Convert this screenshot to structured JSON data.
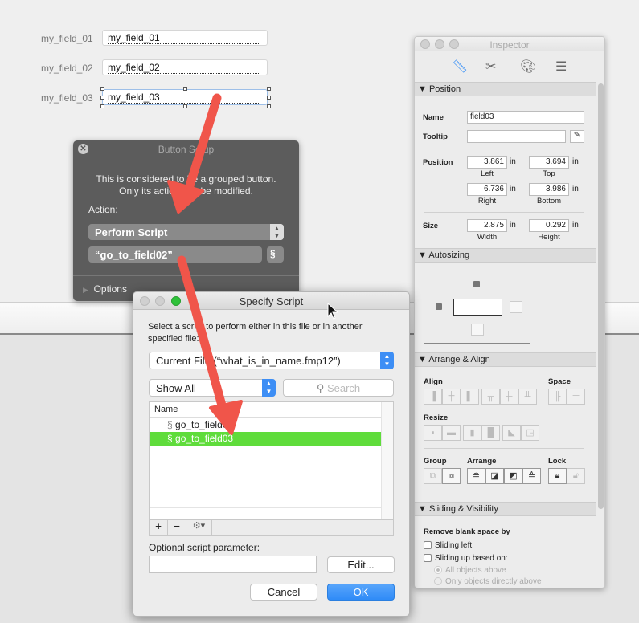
{
  "layout_fields": [
    {
      "label": "my_field_01",
      "value": "my_field_01"
    },
    {
      "label": "my_field_02",
      "value": "my_field_02"
    },
    {
      "label": "my_field_03",
      "value": "my_field_03"
    }
  ],
  "button_setup": {
    "title": "Button Setup",
    "message_line1": "This is considered to be a grouped button.",
    "message_line2": "Only its action can be modified.",
    "action_label": "Action:",
    "action_value": "Perform Script",
    "script_value": "“go_to_field02”",
    "options_label": "Options"
  },
  "specify_script": {
    "title": "Specify Script",
    "instructions": "Select a script to perform either in this file or in another specified file:",
    "file_select": "Current File (“what_is_in_name.fmp12”)",
    "filter_select": "Show All",
    "search_placeholder": "Search",
    "column_name": "Name",
    "scripts": [
      {
        "name": "go_to_field02",
        "selected": false
      },
      {
        "name": "go_to_field03",
        "selected": true
      }
    ],
    "add_label": "+",
    "remove_label": "−",
    "gear_label": "⚙▾",
    "param_label": "Optional script parameter:",
    "param_value": "",
    "edit_label": "Edit...",
    "cancel_label": "Cancel",
    "ok_label": "OK",
    "selection_color": "#5fdc3b",
    "ok_color": "#2f8bf7"
  },
  "inspector": {
    "title": "Inspector",
    "tabs": [
      "position-icon",
      "styles-icon",
      "appearance-icon",
      "data-icon"
    ],
    "position_section": "Position",
    "name_label": "Name",
    "name_value": "field03",
    "tooltip_label": "Tooltip",
    "tooltip_value": "",
    "position_label": "Position",
    "left": "3.861",
    "top": "3.694",
    "right": "6.736",
    "bottom": "3.986",
    "unit": "in",
    "left_label": "Left",
    "top_label": "Top",
    "right_label": "Right",
    "bottom_label": "Bottom",
    "size_label": "Size",
    "width": "2.875",
    "height": "0.292",
    "width_label": "Width",
    "height_label": "Height",
    "autosizing_section": "Autosizing",
    "arrange_section": "Arrange & Align",
    "align_label": "Align",
    "space_label": "Space",
    "resize_label": "Resize",
    "group_label": "Group",
    "arrange_label": "Arrange",
    "lock_label": "Lock",
    "sliding_section": "Sliding & Visibility",
    "remove_blank_label": "Remove blank space by",
    "sliding_left": "Sliding left",
    "sliding_up": "Sliding up based on:",
    "all_objects": "All objects above",
    "only_objects": "Only objects directly above"
  }
}
